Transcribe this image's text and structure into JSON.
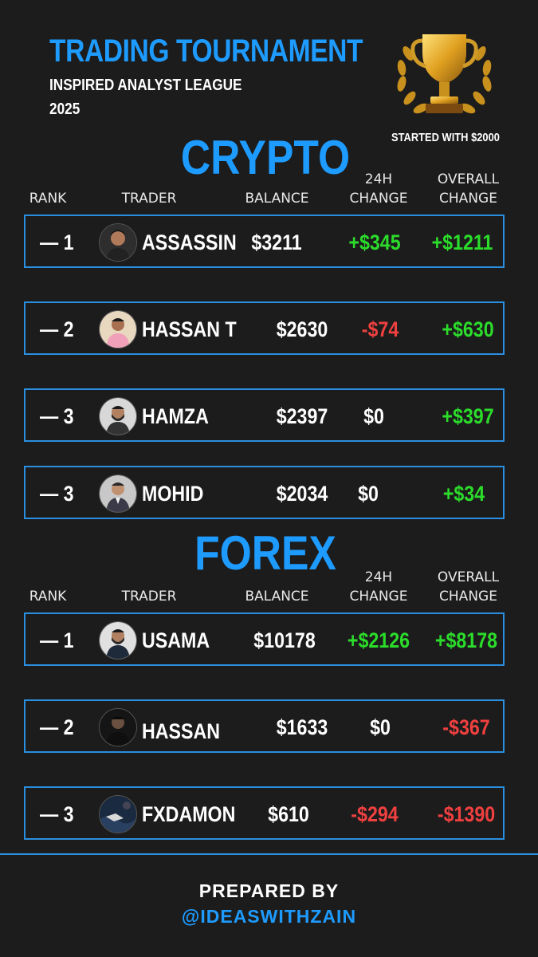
{
  "header": {
    "title": "TRADING TOURNAMENT",
    "subtitle": "INSPIRED ANALYST LEAGUE",
    "year": "2025",
    "started_note": "STARTED WITH $2000",
    "trophy_icon": "trophy-icon"
  },
  "columns": {
    "rank": "RANK",
    "trader": "TRADER",
    "balance": "BALANCE",
    "change_24h_line1": "24H",
    "change_24h_line2": "CHANGE",
    "overall_line1": "OVERALL",
    "overall_line2": "CHANGE"
  },
  "crypto": {
    "title": "CRYPTO",
    "rows": [
      {
        "rank": "— 1",
        "trader": "ASSASSIN",
        "balance": "$3211",
        "change_24h": "+$345",
        "overall": "+$1211"
      },
      {
        "rank": "— 2",
        "trader": "HASSAN T",
        "balance": "$2630",
        "change_24h": "-$74",
        "overall": "+$630"
      },
      {
        "rank": "— 3",
        "trader": "HAMZA",
        "balance": "$2397",
        "change_24h": "$0",
        "overall": "+$397"
      },
      {
        "rank": "— 3",
        "trader": "MOHID",
        "balance": "$2034",
        "change_24h": "$0",
        "overall": "+$34"
      }
    ]
  },
  "forex": {
    "title": "FOREX",
    "rows": [
      {
        "rank": "— 1",
        "trader": "USAMA",
        "balance": "$10178",
        "change_24h": "+$2126",
        "overall": "+$8178"
      },
      {
        "rank": "— 2",
        "trader": "HASSAN",
        "balance": "$1633",
        "change_24h": "$0",
        "overall": "-$367"
      },
      {
        "rank": "— 3",
        "trader": "FXDAMON",
        "balance": "$610",
        "change_24h": "-$294",
        "overall": "-$1390"
      }
    ]
  },
  "footer": {
    "prepared_by": "PREPARED BY",
    "handle": "@IDEASWITHZAIN"
  },
  "colors": {
    "accent": "#1e9bff",
    "positive": "#2bdc2b",
    "negative": "#f04040",
    "background": "#1c1c1c"
  }
}
